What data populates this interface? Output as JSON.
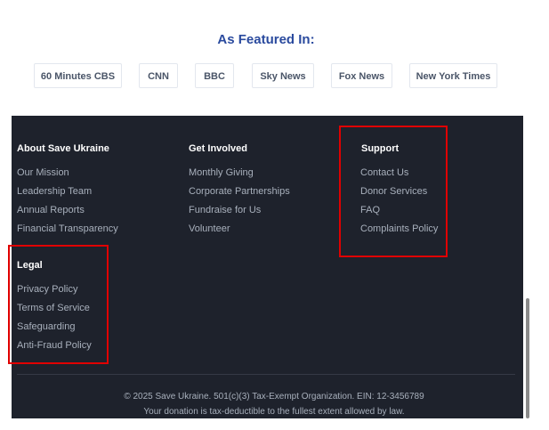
{
  "featured": {
    "title": "As Featured In:",
    "outlets": [
      "60 Minutes CBS",
      "CNN",
      "BBC",
      "Sky News",
      "Fox News",
      "New York Times"
    ]
  },
  "footer": {
    "about": {
      "title": "About Save Ukraine",
      "links": [
        "Our Mission",
        "Leadership Team",
        "Annual Reports",
        "Financial Transparency"
      ]
    },
    "involved": {
      "title": "Get Involved",
      "links": [
        "Monthly Giving",
        "Corporate Partnerships",
        "Fundraise for Us",
        "Volunteer"
      ]
    },
    "support": {
      "title": "Support",
      "links": [
        "Contact Us",
        "Donor Services",
        "FAQ",
        "Complaints Policy"
      ]
    },
    "legal": {
      "title": "Legal",
      "links": [
        "Privacy Policy",
        "Terms of Service",
        "Safeguarding",
        "Anti-Fraud Policy"
      ]
    },
    "copyright": "© 2025 Save Ukraine. 501(c)(3) Tax-Exempt Organization. EIN: 12-3456789",
    "tax_note": "Your donation is tax-deductible to the fullest extent allowed by law."
  },
  "colors": {
    "footer_bg": "#1e222c",
    "heading_blue": "#2a4a9e",
    "highlight_red": "#e00000"
  }
}
